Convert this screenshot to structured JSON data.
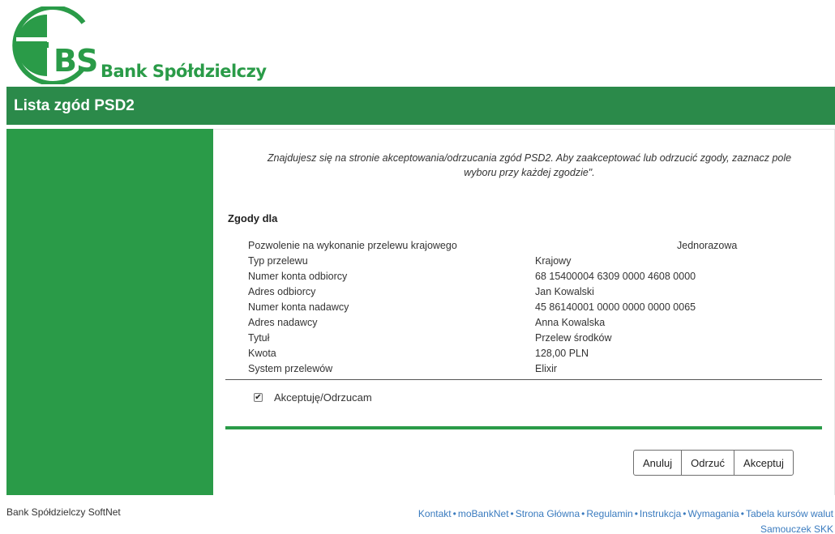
{
  "logo": {
    "letters": "BS",
    "name": "Bank Spółdzielczy",
    "color": "#2a9b48"
  },
  "header": {
    "title": "Lista zgód PSD2",
    "color": "#2b8a4a"
  },
  "intro": {
    "text": "Znajdujesz się na stronie akceptowania/odrzucania zgód PSD2. Aby zaakceptować lub odrzucić zgody, zaznacz pole wyboru przy każdej zgodzie\"."
  },
  "consent": {
    "section_title": "Zgody dla",
    "rows": [
      {
        "label": "Pozwolenie na wykonanie przelewu krajowego",
        "value": "Jednorazowa"
      },
      {
        "label": "Typ przelewu",
        "value": "Krajowy"
      },
      {
        "label": "Numer konta odbiorcy",
        "value": "68 15400004 6309 0000 4608 0000"
      },
      {
        "label": "Adres odbiorcy",
        "value": "Jan Kowalski"
      },
      {
        "label": "Numer konta nadawcy",
        "value": "45 86140001 0000 0000 0000 0065"
      },
      {
        "label": "Adres nadawcy",
        "value": "Anna Kowalska"
      },
      {
        "label": "Tytuł",
        "value": "Przelew środków"
      },
      {
        "label": "Kwota",
        "value": "128,00 PLN"
      },
      {
        "label": "System przelewów",
        "value": "Elixir"
      }
    ],
    "checkbox_label": "Akceptuję/Odrzucam",
    "checkbox_checked": true
  },
  "buttons": {
    "cancel": "Anuluj",
    "reject": "Odrzuć",
    "accept": "Akceptuj"
  },
  "footer": {
    "left": "Bank Spółdzielczy SoftNet",
    "links": [
      "Kontakt",
      "moBankNet",
      "Strona Główna",
      "Regulamin",
      "Instrukcja",
      "Wymagania",
      "Tabela kursów walut"
    ],
    "second_line_link": "Samouczek SKK",
    "separator": "•"
  }
}
